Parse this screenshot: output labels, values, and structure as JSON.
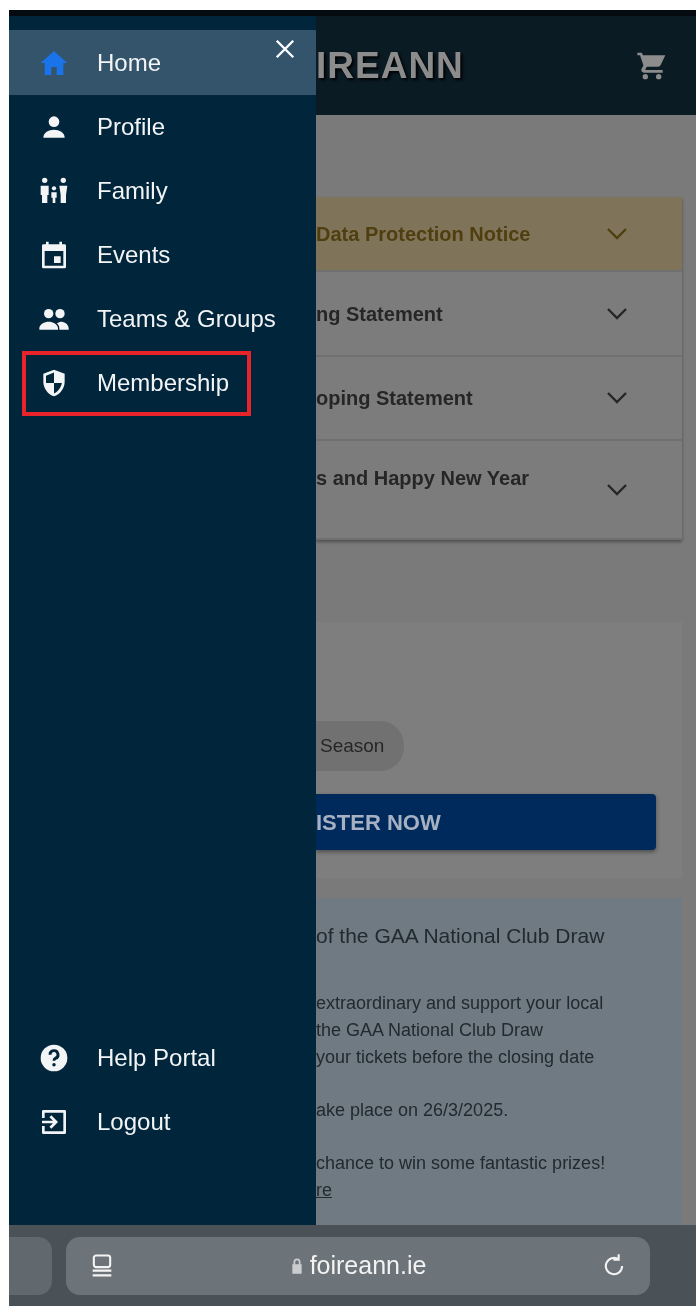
{
  "drawer": {
    "items": [
      {
        "label": "Home",
        "selected": true,
        "highlighted": false
      },
      {
        "label": "Profile",
        "selected": false,
        "highlighted": false
      },
      {
        "label": "Family",
        "selected": false,
        "highlighted": false
      },
      {
        "label": "Events",
        "selected": false,
        "highlighted": false
      },
      {
        "label": "Teams & Groups",
        "selected": false,
        "highlighted": false
      },
      {
        "label": "Membership",
        "selected": false,
        "highlighted": true
      }
    ],
    "footer_items": [
      {
        "label": "Help Portal"
      },
      {
        "label": "Logout"
      }
    ]
  },
  "header": {
    "logo": "IREANN"
  },
  "accordion": [
    {
      "title": "Data Protection Notice",
      "kind": "notice"
    },
    {
      "title": "ng Statement",
      "kind": "plain"
    },
    {
      "title": "oping Statement",
      "kind": "plain"
    },
    {
      "title": "s and Happy New Year",
      "kind": "plain"
    }
  ],
  "registration_card": {
    "chip": "Season",
    "button": "ISTER NOW"
  },
  "info_card": {
    "title": "of the GAA National Club Draw",
    "paragraphs": [
      [
        "extraordinary and support your local",
        "the GAA National Club Draw",
        "your tickets before the closing date"
      ],
      [
        "ake place on 26/3/2025."
      ],
      [
        "chance to win some fantastic prizes!"
      ]
    ],
    "link": "re"
  },
  "browser_bar": {
    "url": "foireann.ie"
  }
}
